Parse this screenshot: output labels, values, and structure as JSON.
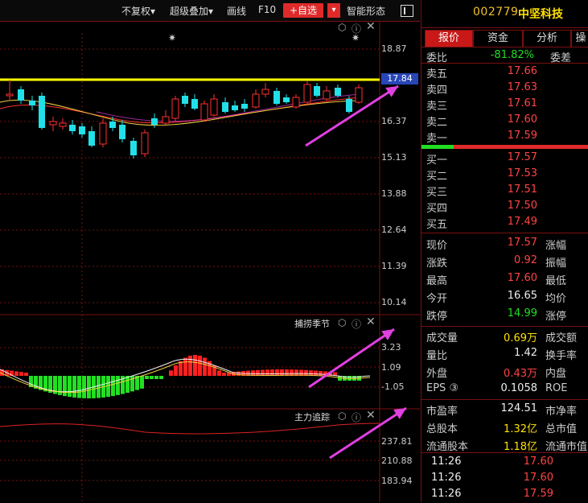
{
  "toolbar": {
    "fuquan": "不复权▾",
    "overlay": "超级叠加▾",
    "drawline": "画线",
    "f10": "F10",
    "add_watch": "+自选",
    "add_watch_arrow": "▾",
    "smart_pattern": "智能形态"
  },
  "main_chart": {
    "y_labels": [
      "18.87",
      "17.84",
      "16.37",
      "15.13",
      "13.88",
      "12.64",
      "11.39",
      "10.14"
    ],
    "highlight_price": "17.84"
  },
  "panel2": {
    "title": "捕捞季节",
    "y_labels": [
      "3.23",
      "1.09",
      "-1.05"
    ]
  },
  "panel3": {
    "title": "主力追踪",
    "y_labels": [
      "237.81",
      "210.88",
      "183.94"
    ]
  },
  "quote": {
    "code": "002779",
    "name": "中坚科技",
    "tabs": [
      "报价",
      "资金",
      "分析",
      "操"
    ],
    "wei_bi_label": "委比",
    "wei_bi_value": "-81.82%",
    "wei_cha_label": "委差",
    "sell": [
      {
        "label": "卖五",
        "price": "17.66"
      },
      {
        "label": "卖四",
        "price": "17.63"
      },
      {
        "label": "卖三",
        "price": "17.61"
      },
      {
        "label": "卖二",
        "price": "17.60"
      },
      {
        "label": "卖一",
        "price": "17.59"
      }
    ],
    "buy": [
      {
        "label": "买一",
        "price": "17.57"
      },
      {
        "label": "买二",
        "price": "17.53"
      },
      {
        "label": "买三",
        "price": "17.51"
      },
      {
        "label": "买四",
        "price": "17.50"
      },
      {
        "label": "买五",
        "price": "17.49"
      }
    ],
    "stats1": [
      {
        "label": "现价",
        "value": "17.57",
        "label2": "涨幅"
      },
      {
        "label": "涨跌",
        "value": "0.92",
        "label2": "振幅"
      },
      {
        "label": "最高",
        "value": "17.60",
        "label2": "最低"
      },
      {
        "label": "今开",
        "value": "16.65",
        "label2": "均价"
      },
      {
        "label": "跌停",
        "value": "14.99",
        "label2": "涨停"
      }
    ],
    "stats2": [
      {
        "label": "成交量",
        "value": "0.69万",
        "label2": "成交额"
      },
      {
        "label": "量比",
        "value": "1.42",
        "label2": "换手率"
      },
      {
        "label": "外盘",
        "value": "0.43万",
        "label2": "内盘"
      },
      {
        "label": "EPS ③",
        "value": "0.1058",
        "label2": "ROE"
      }
    ],
    "stats3": [
      {
        "label": "市盈率",
        "value": "124.51",
        "label2": "市净率"
      },
      {
        "label": "总股本",
        "value": "1.32亿",
        "label2": "总市值"
      },
      {
        "label": "流通股本",
        "value": "1.18亿",
        "label2": "流通市值"
      }
    ],
    "ticks": [
      {
        "time": "11:26",
        "price": "17.60"
      },
      {
        "time": "11:26",
        "price": "17.60"
      },
      {
        "time": "11:26",
        "price": "17.59"
      }
    ]
  },
  "colors": {
    "up": "#ff3030",
    "down": "#22e0e8",
    "highlight_line": "#ffff00",
    "arrow": "#e040e0"
  }
}
